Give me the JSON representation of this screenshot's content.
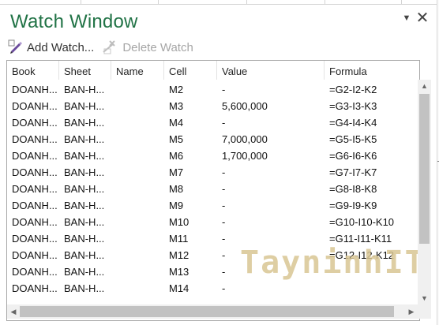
{
  "window": {
    "title": "Watch Window",
    "dropdown_glyph": "▼",
    "close_glyph": "✕"
  },
  "toolbar": {
    "add_watch": {
      "label": "Add Watch...",
      "icon": "add-watch-icon"
    },
    "delete_watch": {
      "label": "Delete Watch",
      "icon": "delete-watch-icon",
      "disabled": true
    }
  },
  "table": {
    "columns": [
      "Book",
      "Sheet",
      "Name",
      "Cell",
      "Value",
      "Formula"
    ],
    "rows": [
      {
        "book": "DOANH...",
        "sheet": "BAN-H...",
        "name": "",
        "cell": "M2",
        "value": "-",
        "formula": "=G2-I2-K2"
      },
      {
        "book": "DOANH...",
        "sheet": "BAN-H...",
        "name": "",
        "cell": "M3",
        "value": "5,600,000",
        "formula": "=G3-I3-K3"
      },
      {
        "book": "DOANH...",
        "sheet": "BAN-H...",
        "name": "",
        "cell": "M4",
        "value": "-",
        "formula": "=G4-I4-K4"
      },
      {
        "book": "DOANH...",
        "sheet": "BAN-H...",
        "name": "",
        "cell": "M5",
        "value": "7,000,000",
        "formula": "=G5-I5-K5"
      },
      {
        "book": "DOANH...",
        "sheet": "BAN-H...",
        "name": "",
        "cell": "M6",
        "value": "1,700,000",
        "formula": "=G6-I6-K6"
      },
      {
        "book": "DOANH...",
        "sheet": "BAN-H...",
        "name": "",
        "cell": "M7",
        "value": "-",
        "formula": "=G7-I7-K7"
      },
      {
        "book": "DOANH...",
        "sheet": "BAN-H...",
        "name": "",
        "cell": "M8",
        "value": "-",
        "formula": "=G8-I8-K8"
      },
      {
        "book": "DOANH...",
        "sheet": "BAN-H...",
        "name": "",
        "cell": "M9",
        "value": "-",
        "formula": "=G9-I9-K9"
      },
      {
        "book": "DOANH...",
        "sheet": "BAN-H...",
        "name": "",
        "cell": "M10",
        "value": "-",
        "formula": "=G10-I10-K10"
      },
      {
        "book": "DOANH...",
        "sheet": "BAN-H...",
        "name": "",
        "cell": "M11",
        "value": "-",
        "formula": "=G11-I11-K11"
      },
      {
        "book": "DOANH...",
        "sheet": "BAN-H...",
        "name": "",
        "cell": "M12",
        "value": "-",
        "formula": "=G12-I12-K12"
      },
      {
        "book": "DOANH...",
        "sheet": "BAN-H...",
        "name": "",
        "cell": "M13",
        "value": "-",
        "formula": ""
      },
      {
        "book": "DOANH...",
        "sheet": "BAN-H...",
        "name": "",
        "cell": "M14",
        "value": "-",
        "formula": ""
      }
    ]
  },
  "watermark": {
    "text": "TayninhIT"
  },
  "colors": {
    "title": "#217346",
    "scrollbar_track": "#f0f0f0",
    "scrollbar_thumb": "#c2c2c2"
  }
}
